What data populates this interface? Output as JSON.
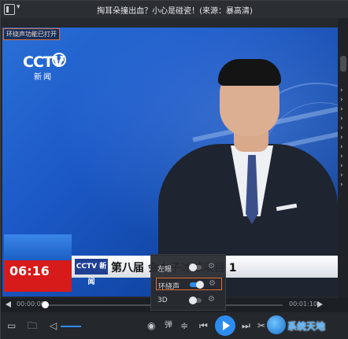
{
  "window": {
    "title": "掏耳朵撞出血？小心是碰瓷！(来源：暴高清)"
  },
  "notice": {
    "text": "环绕声功能已打开"
  },
  "video": {
    "channel_logo": "CCTV",
    "channel_number": "13",
    "channel_sub": "新闻",
    "clock": "06:16",
    "ticker_badge": "CCTV 新闻",
    "ticker_text": "第八届   会女子冰球项目 1"
  },
  "popup": {
    "items": [
      {
        "label": "左眼",
        "on": false
      },
      {
        "label": "环绕声",
        "on": true
      },
      {
        "label": "3D",
        "on": false
      }
    ]
  },
  "progress": {
    "current": "00:00:00",
    "total": "00:01:10",
    "fraction": 0.0
  },
  "watermark": {
    "text": "系统天地"
  },
  "icons": {
    "menu": "menu-icon",
    "open_folder": "folder-icon",
    "playlist": "playlist-icon",
    "volume": "volume-icon",
    "eye": "eye-icon",
    "subtitle": "subtitle-icon",
    "equalizer": "equalizer-icon",
    "prev": "prev-icon",
    "play": "play-icon",
    "next": "next-icon",
    "scissors": "scissors-icon"
  },
  "colors": {
    "accent": "#2d8cf0",
    "highlight": "#e46a2b",
    "clock_bg": "#d71a1a"
  }
}
